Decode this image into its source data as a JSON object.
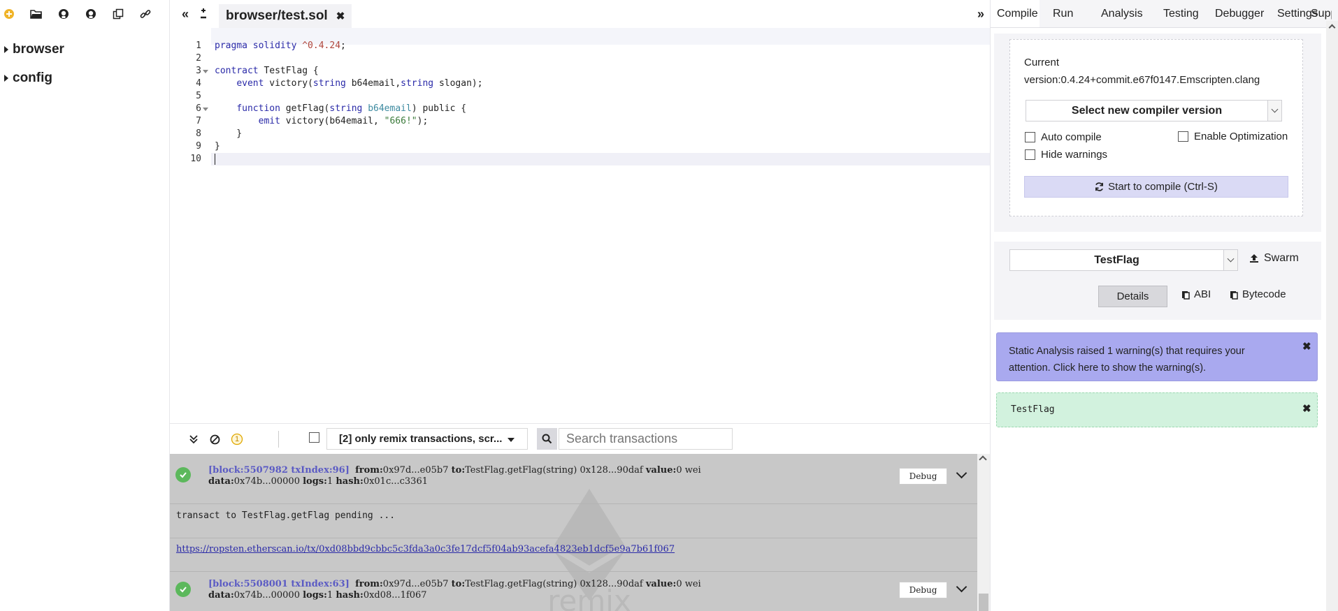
{
  "file_explorer": {
    "toolbar_icons": [
      "add-file-icon",
      "open-folder-icon",
      "github-publish-icon",
      "github-update-icon",
      "copy-files-icon",
      "connect-localhost-icon"
    ],
    "tree": [
      {
        "label": "browser"
      },
      {
        "label": "config"
      }
    ]
  },
  "editor": {
    "tab_label": "browser/test.sol",
    "line_numbers": [
      "1",
      "2",
      "3",
      "4",
      "5",
      "6",
      "7",
      "8",
      "9",
      "10"
    ]
  },
  "code": {
    "l1_kw": "pragma solidity",
    "l1_ver": "^0.4.24",
    "l1_end": ";",
    "l3_kw": "contract",
    "l3_rest": " TestFlag {",
    "l4_indent": "    ",
    "l4_kw": "event",
    "l4_a": " victory(",
    "l4_t1": "string",
    "l4_b": " b64email,",
    "l4_t2": "string",
    "l4_c": " slogan);",
    "l6_indent": "    ",
    "l6_kw": "function",
    "l6_a": " getFlag(",
    "l6_t1": "string",
    "l6_sp": " ",
    "l6_param": "b64email",
    "l6_b": ") public {",
    "l7_indent": "        ",
    "l7_kw": "emit",
    "l7_a": " victory(b64email, ",
    "l7_str": "\"666!\"",
    "l7_b": ");",
    "l8": "    }",
    "l9": "}"
  },
  "terminal": {
    "filter_label": "[2] only remix transactions, scr...",
    "search_placeholder": "Search transactions",
    "pending_count": "1",
    "tx1": {
      "block": "[block:5507982 txIndex:96]",
      "from_label": "from:",
      "from": "0x97d...e05b7",
      "to_label": "to:",
      "to": "TestFlag.getFlag(string) 0x128...90daf",
      "value_label": "value:",
      "value": "0 wei",
      "data_label": "data:",
      "data": "0x74b...00000",
      "logs_label": "logs:",
      "logs": "1",
      "hash_label": "hash:",
      "hash": "0x01c...c3361",
      "debug": "Debug"
    },
    "pending_msg": "transact to TestFlag.getFlag pending ...",
    "etherscan_link": "https://ropsten.etherscan.io/tx/0xd08bbd9cbbc5c3fda3a0c3fe17dcf5f04ab93acefa4823eb1dcf5e9a7b61f067",
    "tx2": {
      "block": "[block:5508001 txIndex:63]",
      "from_label": "from:",
      "from": "0x97d...e05b7",
      "to_label": "to:",
      "to": "TestFlag.getFlag(string) 0x128...90daf",
      "value_label": "value:",
      "value": "0 wei",
      "data_label": "data:",
      "data": "0x74b...00000",
      "logs_label": "logs:",
      "logs": "1",
      "hash_label": "hash:",
      "hash": "0xd08...1f067",
      "debug": "Debug"
    }
  },
  "right_panel": {
    "tabs": [
      "Compile",
      "Run",
      "Analysis",
      "Testing",
      "Debugger",
      "Settings",
      "Support"
    ],
    "active_tab": "Compile",
    "compile": {
      "current_label": "Current",
      "version": "version:0.4.24+commit.e67f0147.Emscripten.clang",
      "select_label": "Select new compiler version",
      "auto_compile": "Auto compile",
      "enable_optimization": "Enable Optimization",
      "hide_warnings": "Hide warnings",
      "compile_button": "Start to compile (Ctrl-S)"
    },
    "contract": {
      "selected": "TestFlag",
      "swarm": "Swarm",
      "details": "Details",
      "abi": "ABI",
      "bytecode": "Bytecode"
    },
    "warning": {
      "text": "Static Analysis raised 1 warning(s) that requires your attention. Click here to show the warning(s)."
    },
    "success": {
      "text": "TestFlag"
    }
  },
  "colors": {
    "warning_bg": "#a9a9ef",
    "success_bg": "#d2f2de",
    "compile_button_bg": "#dadaf5",
    "terminal_bg": "#c8c8c8",
    "tx_success": "#5cb85c"
  }
}
